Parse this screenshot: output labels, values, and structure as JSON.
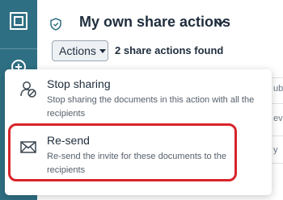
{
  "header": {
    "title": "My own share actions"
  },
  "toolbar": {
    "actions_label": "Actions",
    "results_text": "2 share actions found"
  },
  "menu": {
    "items": [
      {
        "title": "Stop sharing",
        "description": "Stop sharing the documents in this action with all the recipients",
        "icon": "stop-sharing-icon"
      },
      {
        "title": "Re-send",
        "description": "Re-send the invite for these documents to the recipients",
        "icon": "envelope-icon"
      }
    ]
  },
  "background_fragments": [
    "ub",
    "ev",
    "y"
  ],
  "colors": {
    "rail": "#2f6f83",
    "highlight": "#d8232a",
    "text": "#1f2d3d"
  }
}
